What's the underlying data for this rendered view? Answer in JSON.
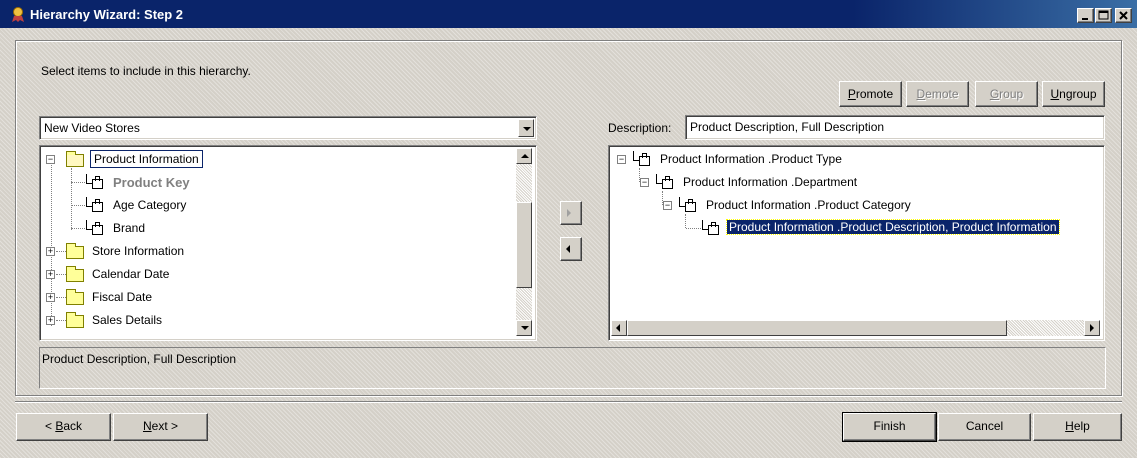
{
  "window": {
    "title": "Hierarchy Wizard: Step 2",
    "controls": {
      "minimize": "_",
      "maximize": "□",
      "close": "×"
    }
  },
  "instruction": "Select items to include in this hierarchy.",
  "toolbar": {
    "promote": {
      "label": "Promote",
      "enabled": true
    },
    "demote": {
      "label": "Demote",
      "enabled": false
    },
    "group": {
      "label": "Group",
      "enabled": false
    },
    "ungroup": {
      "label": "Ungroup",
      "enabled": true
    }
  },
  "source": {
    "selected": "New Video Stores",
    "tree": [
      {
        "label": "Product Information",
        "type": "folder",
        "expanded": true,
        "focused": true
      },
      {
        "label": "Product Key",
        "type": "level",
        "bold": true,
        "gray": true
      },
      {
        "label": "Age Category",
        "type": "level"
      },
      {
        "label": "Brand",
        "type": "level"
      },
      {
        "label": "Store Information",
        "type": "folder",
        "expanded": false
      },
      {
        "label": "Calendar Date",
        "type": "folder",
        "expanded": false
      },
      {
        "label": "Fiscal Date",
        "type": "folder",
        "expanded": false
      },
      {
        "label": "Sales Details",
        "type": "folder",
        "expanded": false
      }
    ]
  },
  "move_buttons": {
    "add": "▶",
    "remove": "◀"
  },
  "description": {
    "label": "Description:",
    "value": "Product Description, Full Description"
  },
  "hierarchy_tree": [
    {
      "label": "Product Information .Product Type",
      "level": 0
    },
    {
      "label": "Product Information .Department",
      "level": 1
    },
    {
      "label": "Product Information .Product Category",
      "level": 2
    },
    {
      "label": "Product Information .Product Description, Product Information",
      "level": 3,
      "selected": true
    }
  ],
  "status_text": "Product Description, Full Description",
  "footer": {
    "back": {
      "prefix": "< ",
      "accel": "B",
      "rest": "ack"
    },
    "next": {
      "accel": "N",
      "rest": "ext >"
    },
    "finish": "Finish",
    "cancel": "Cancel",
    "help": {
      "accel": "H",
      "rest": "elp"
    }
  },
  "colors": {
    "title_bar": "#0a246a",
    "face": "#d4d0c8",
    "selection": "#0a246a"
  }
}
